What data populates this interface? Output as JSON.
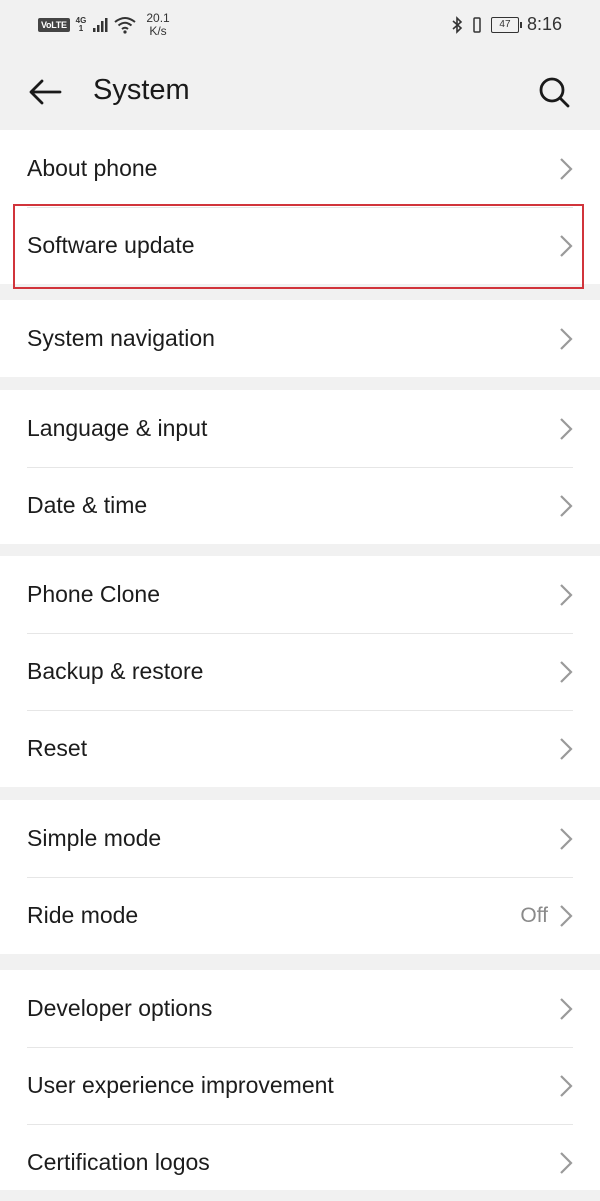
{
  "status_bar": {
    "volte": "VoLTE",
    "network_type": "4G",
    "network_sub": "1",
    "net_speed_value": "20.1",
    "net_speed_unit": "K/s",
    "battery": "47",
    "time": "8:16"
  },
  "header": {
    "title": "System",
    "back_icon": "arrow-left-icon",
    "search_icon": "search-icon"
  },
  "groups": [
    {
      "items": [
        {
          "label": "About phone",
          "value": ""
        },
        {
          "label": "Software update",
          "value": ""
        }
      ]
    },
    {
      "items": [
        {
          "label": "System navigation",
          "value": ""
        }
      ]
    },
    {
      "items": [
        {
          "label": "Language & input",
          "value": ""
        },
        {
          "label": "Date & time",
          "value": ""
        }
      ]
    },
    {
      "items": [
        {
          "label": "Phone Clone",
          "value": ""
        },
        {
          "label": "Backup & restore",
          "value": ""
        },
        {
          "label": "Reset",
          "value": ""
        }
      ]
    },
    {
      "items": [
        {
          "label": "Simple mode",
          "value": ""
        },
        {
          "label": "Ride mode",
          "value": "Off"
        }
      ]
    },
    {
      "items": [
        {
          "label": "Developer options",
          "value": ""
        },
        {
          "label": "User experience improvement",
          "value": ""
        },
        {
          "label": "Certification logos",
          "value": ""
        }
      ]
    }
  ],
  "colors": {
    "highlight": "#d1343b",
    "background": "#f1f1f1",
    "card": "#ffffff"
  }
}
